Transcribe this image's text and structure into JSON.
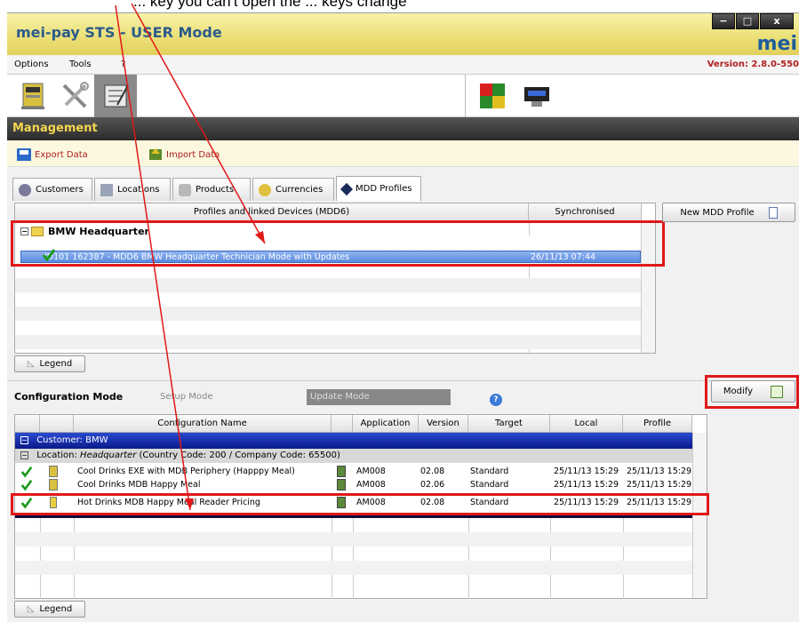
{
  "caption": "... key you can't open the ... keys change",
  "window": {
    "title": "mei-pay STS - USER Mode",
    "logo": "mei",
    "minimize": "−",
    "maximize": "□",
    "close": "x"
  },
  "menu": {
    "items": [
      "Options",
      "Tools",
      "?"
    ],
    "version": "Version: 2.8.0-550"
  },
  "section_title": "Management",
  "actions": {
    "export": "Export Data",
    "import": "Import Data"
  },
  "tabs": [
    "Customers",
    "Locations",
    "Products",
    "Currencies",
    "MDD Profiles"
  ],
  "profiles_grid": {
    "col_profiles": "Profiles and linked Devices (MDD6)",
    "col_sync": "Synchronised",
    "group": "BMW Headquarter",
    "row_text": "ID101  162387  -  MDD6 BMW Headquarter Technician Mode with Updates",
    "row_sync": "26/11/13 07:44"
  },
  "new_profile_button": "New MDD Profile",
  "legend_button": "Legend",
  "config": {
    "title": "Configuration Mode",
    "setup_mode": "Setup Mode",
    "update_mode": "Update Mode",
    "modify_button": "Modify"
  },
  "config_grid": {
    "headers": [
      "Configuration Name",
      "Application",
      "Version",
      "Target",
      "Local",
      "Profile"
    ],
    "customer_row": "Customer: BMW",
    "location_label": "Location:",
    "location_name": "Headquarter",
    "location_codes": "(Country Code: 200 / Company Code: 65500)",
    "rows": [
      {
        "name": "Cool Drinks EXE with MDB Periphery (Happpy Meal)",
        "app": "AM008",
        "version": "02.08",
        "target": "Standard",
        "local": "25/11/13 15:29",
        "profile": "25/11/13 15:29"
      },
      {
        "name": "Cool Drinks MDB Happy Meal",
        "app": "AM008",
        "version": "02.06",
        "target": "Standard",
        "local": "25/11/13 15:29",
        "profile": "25/11/13 15:29"
      },
      {
        "name": "Hot Drinks MDB Happy Meal Reader Pricing",
        "app": "AM008",
        "version": "02.08",
        "target": "Standard",
        "local": "25/11/13 15:29",
        "profile": "25/11/13 15:29"
      }
    ]
  }
}
